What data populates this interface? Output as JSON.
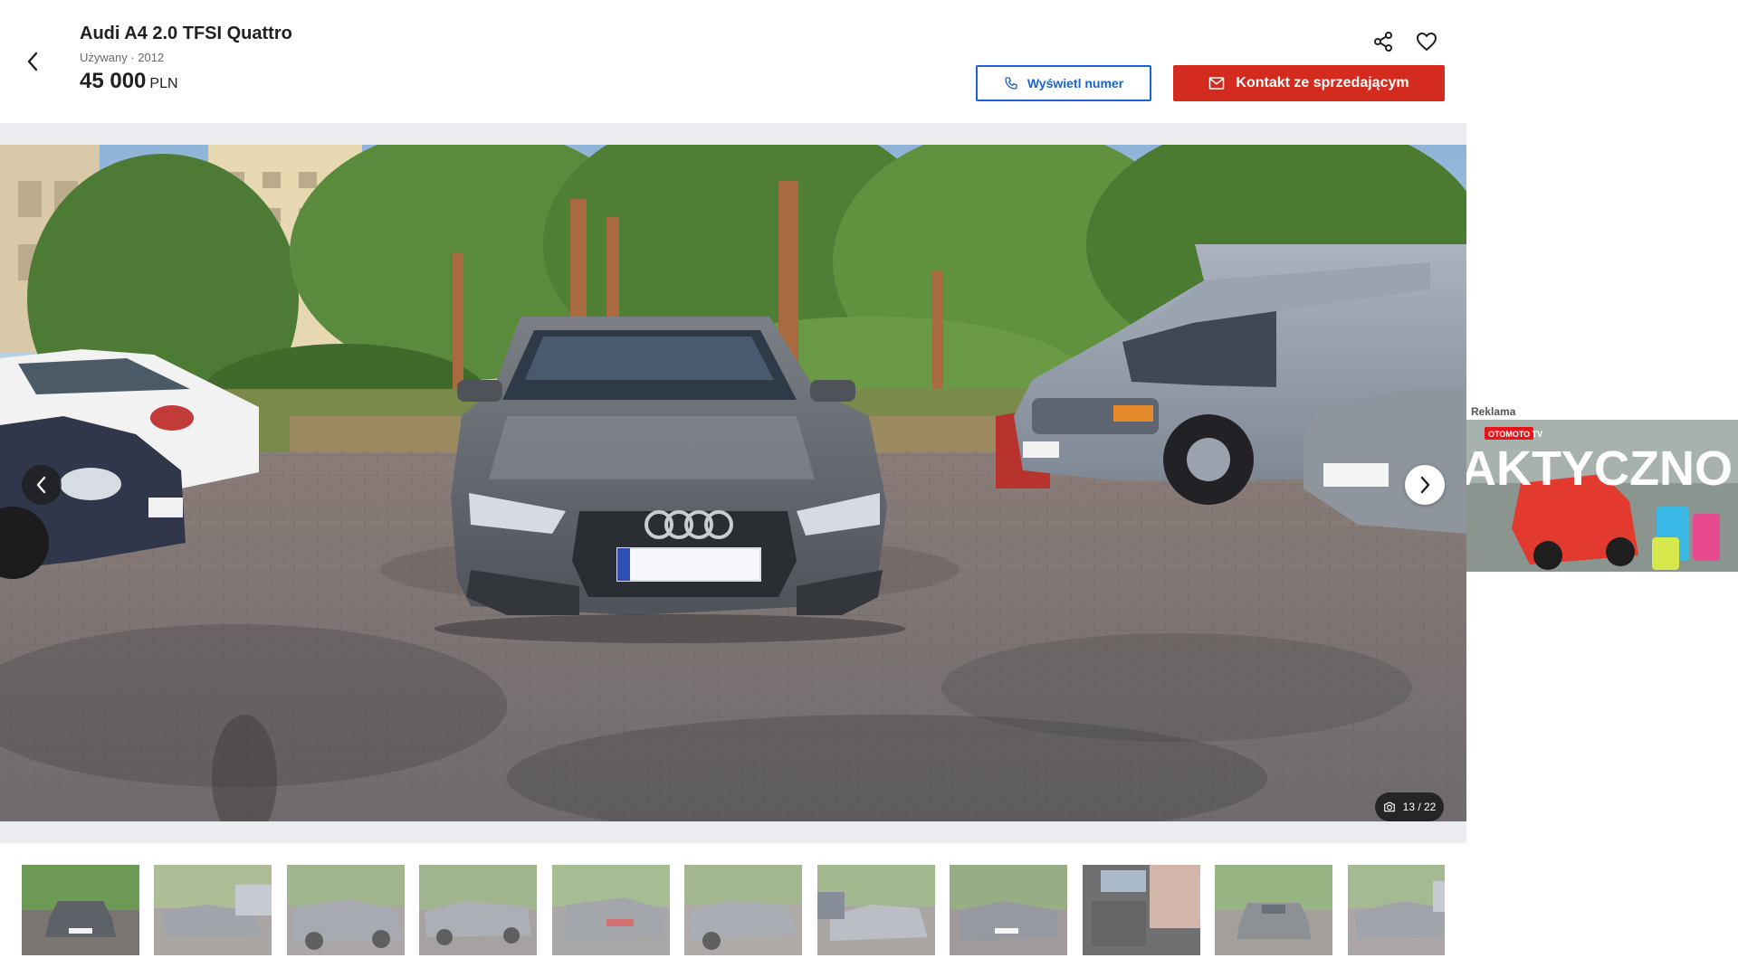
{
  "listing": {
    "title": "Audi A4 2.0 TFSI Quattro",
    "subtitle": "Używany · 2012",
    "price_amount": "45 000",
    "price_currency": "PLN"
  },
  "actions": {
    "show_number_label": "Wyświetl numer",
    "contact_label": "Kontakt ze sprzedającym"
  },
  "gallery": {
    "counter": "13 / 22",
    "current_index": 13,
    "total": 22,
    "thumbnail_count": 12
  },
  "ad": {
    "label": "Reklama",
    "brand": "OTOMOTO TV",
    "headline": "AKTYCZNO"
  },
  "colors": {
    "primary_red": "#d42b1f",
    "link_blue": "#1b63d5"
  },
  "icons": {
    "back": "chevron-left-icon",
    "share": "share-icon",
    "favorite": "heart-icon",
    "phone": "phone-icon",
    "mail": "mail-icon",
    "camera": "camera-icon"
  }
}
